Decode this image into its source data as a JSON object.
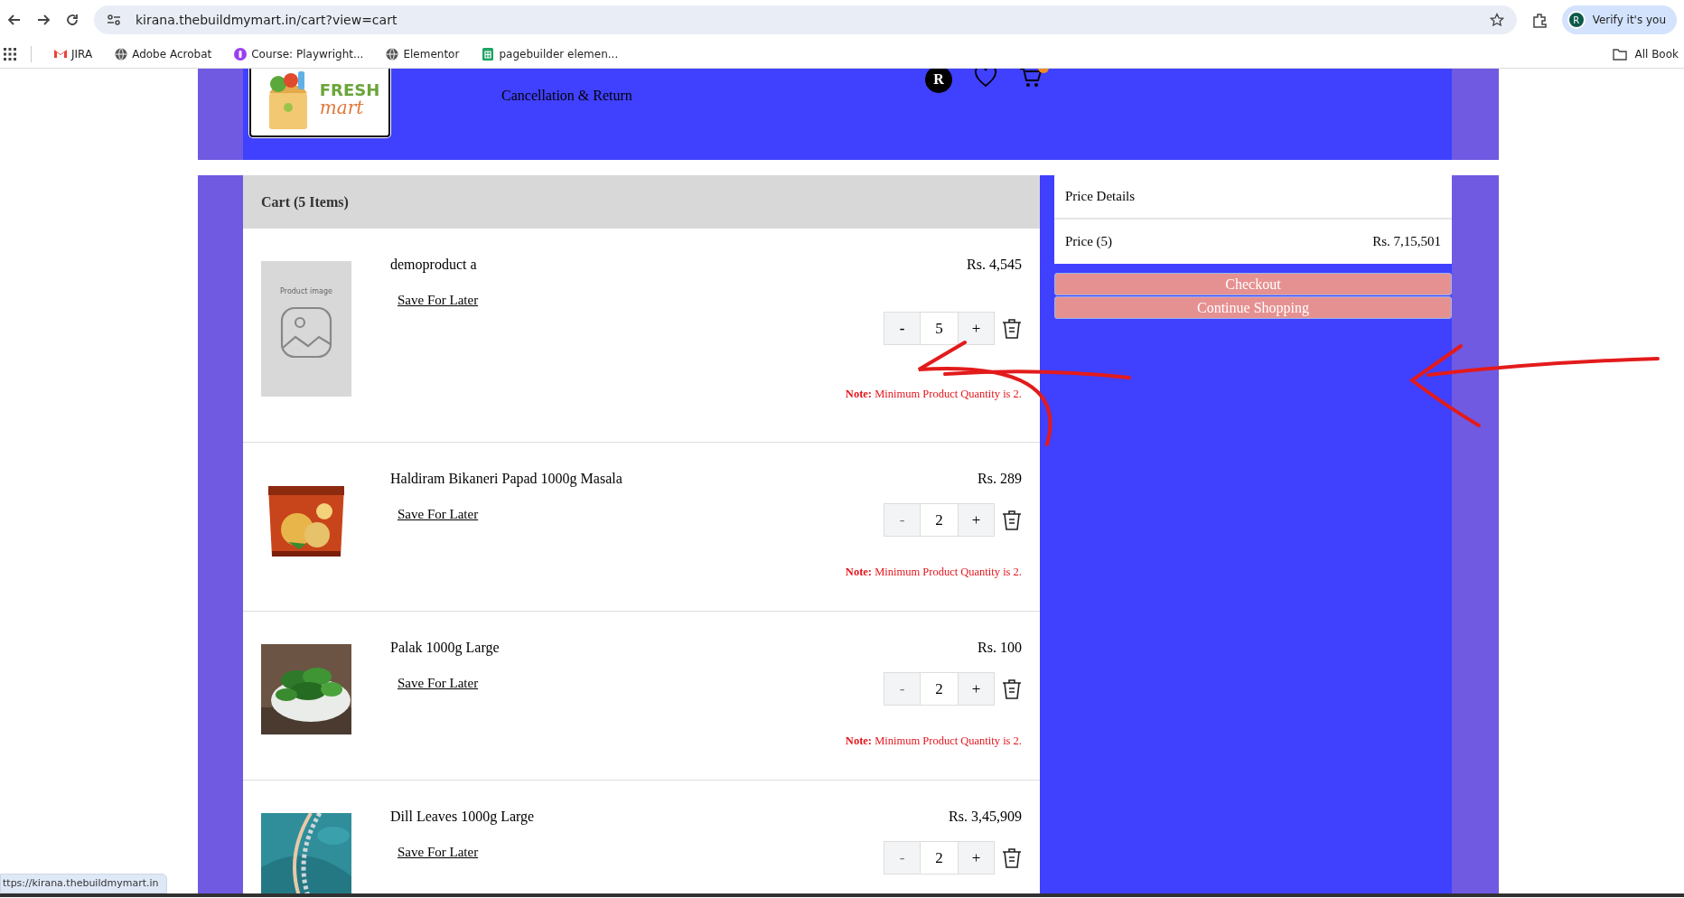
{
  "browser": {
    "url": "kirana.thebuildmymart.in/cart?view=cart",
    "profile_initial": "R",
    "profile_label": "Verify it's you",
    "bookmarks": [
      {
        "kind": "gmail",
        "label": "JIRA"
      },
      {
        "kind": "globe",
        "label": "Adobe Acrobat"
      },
      {
        "kind": "course",
        "label": "Course: Playwright..."
      },
      {
        "kind": "globe",
        "label": "Elementor"
      },
      {
        "kind": "sheet",
        "label": "pagebuilder elemen..."
      }
    ],
    "all_bookmarks": "All Book"
  },
  "header": {
    "logo": {
      "line1": "FRESH",
      "line2": "mart"
    },
    "nav_items": [
      "Cancellation & Return"
    ],
    "account_initial": "R"
  },
  "cart": {
    "title": "Cart (5 Items)",
    "items": [
      {
        "image": {
          "kind": "placeholder",
          "label": "Product image"
        },
        "name": "demoproduct a",
        "price": "Rs. 4,545",
        "save_label": "Save For Later",
        "quantity": "5",
        "minus": "-",
        "plus": "+",
        "minus_disabled": false,
        "note": "**Note:** Minimum Product Quantity is 2."
      },
      {
        "name": "Haldiram Bikaneri Papad 1000g Masala",
        "price": "Rs. 289",
        "save_label": "Save For Later",
        "quantity": "2",
        "minus": "-",
        "plus": "+",
        "minus_disabled": true,
        "note": "**Note:** Minimum Product Quantity is 2."
      },
      {
        "name": "Palak 1000g Large",
        "price": "Rs. 100",
        "save_label": "Save For Later",
        "quantity": "2",
        "minus": "-",
        "plus": "+",
        "minus_disabled": true,
        "note": "**Note:** Minimum Product Quantity is 2."
      },
      {
        "name": "Dill Leaves 1000g Large",
        "price": "Rs. 3,45,909",
        "save_label": "Save For Later",
        "quantity": "2",
        "minus": "-",
        "plus": "+",
        "minus_disabled": true
      }
    ]
  },
  "price_details": {
    "title": "Price Details",
    "rows": [
      {
        "label": "Price (5)",
        "value": "Rs. 7,15,501"
      }
    ],
    "buttons": [
      "Checkout",
      "Continue Shopping"
    ]
  },
  "status_url": "ttps://kirana.thebuildmymart.in"
}
